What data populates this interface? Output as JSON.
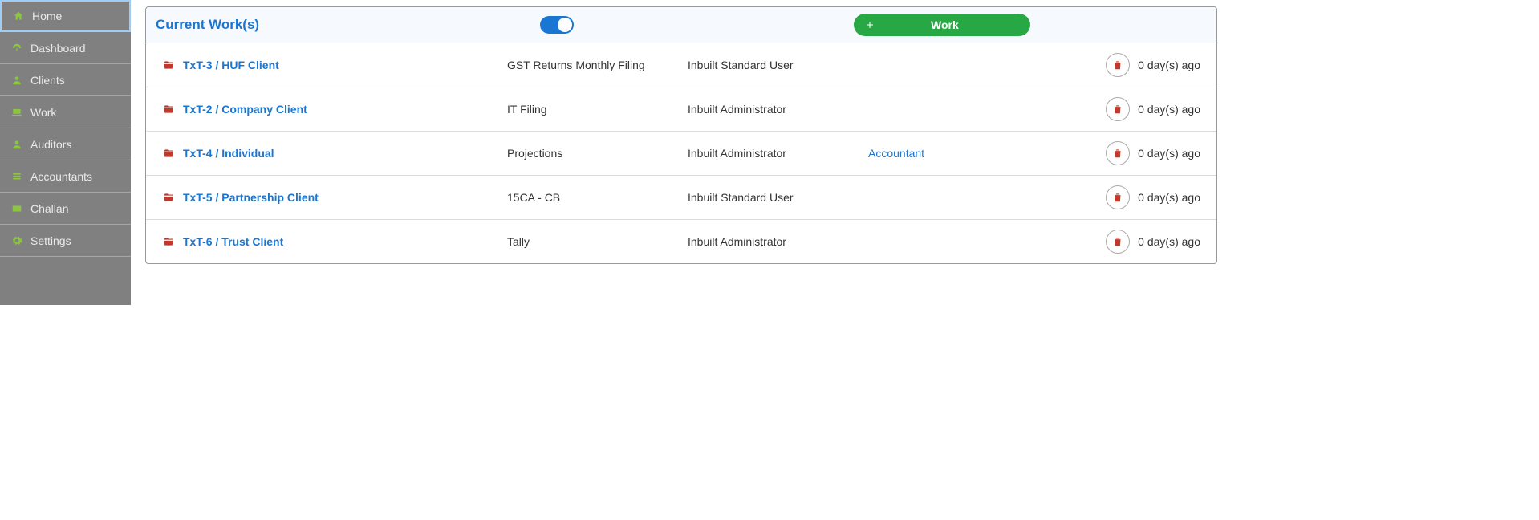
{
  "sidebar": {
    "items": [
      {
        "label": "Home",
        "icon": "home",
        "active": true
      },
      {
        "label": "Dashboard",
        "icon": "dashboard",
        "active": false
      },
      {
        "label": "Clients",
        "icon": "user",
        "active": false
      },
      {
        "label": "Work",
        "icon": "laptop",
        "active": false
      },
      {
        "label": "Auditors",
        "icon": "user",
        "active": false
      },
      {
        "label": "Accountants",
        "icon": "list",
        "active": false
      },
      {
        "label": "Challan",
        "icon": "card",
        "active": false
      },
      {
        "label": "Settings",
        "icon": "gear",
        "active": false
      }
    ]
  },
  "panel": {
    "title": "Current Work(s)",
    "toggle_on": true,
    "action_button": "Work"
  },
  "rows": [
    {
      "client": "TxT-3 / HUF Client",
      "task": "GST Returns Monthly Filing",
      "user": "Inbuilt Standard User",
      "role": "",
      "age": "0 day(s) ago"
    },
    {
      "client": "TxT-2 / Company Client",
      "task": "IT Filing",
      "user": "Inbuilt Administrator",
      "role": "",
      "age": "0 day(s) ago"
    },
    {
      "client": "TxT-4 / Individual",
      "task": "Projections",
      "user": "Inbuilt Administrator",
      "role": "Accountant",
      "age": "0 day(s) ago"
    },
    {
      "client": "TxT-5 / Partnership Client",
      "task": "15CA - CB",
      "user": "Inbuilt Standard User",
      "role": "",
      "age": "0 day(s) ago"
    },
    {
      "client": "TxT-6 / Trust Client",
      "task": "Tally",
      "user": "Inbuilt Administrator",
      "role": "",
      "age": "0 day(s) ago"
    }
  ]
}
